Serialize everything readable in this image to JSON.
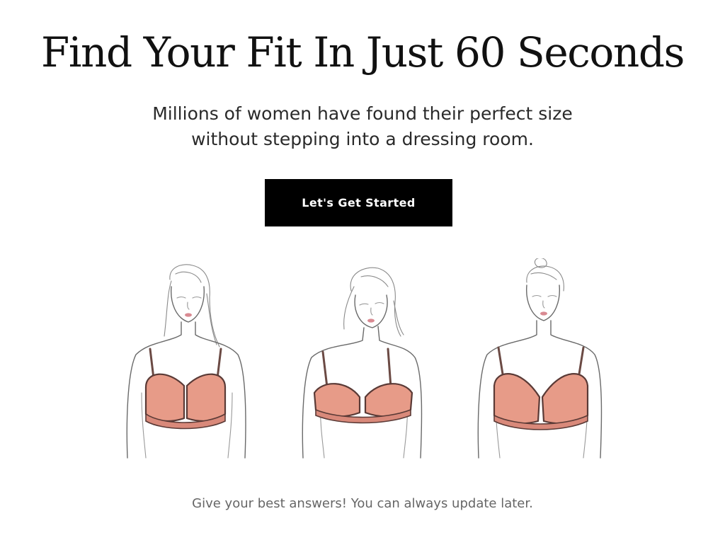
{
  "header": {
    "title": "Find Your Fit In Just 60 Seconds",
    "subtitle_line1": "Millions of women have found their perfect size",
    "subtitle_line2": "without stepping into a dressing room."
  },
  "cta": {
    "label": "Let's Get Started"
  },
  "illustrations": [
    {
      "icon": "woman-in-bra-illustration",
      "hair": "long-straight"
    },
    {
      "icon": "woman-in-bra-illustration",
      "hair": "shoulder-length"
    },
    {
      "icon": "woman-in-bra-illustration",
      "hair": "updo-bun"
    }
  ],
  "footer": {
    "note": "Give your best answers! You can always update later."
  },
  "colors": {
    "background": "#ffffff",
    "button": "#000000",
    "button_text": "#ffffff",
    "bra": "#e79b88",
    "note_text": "#666666"
  }
}
